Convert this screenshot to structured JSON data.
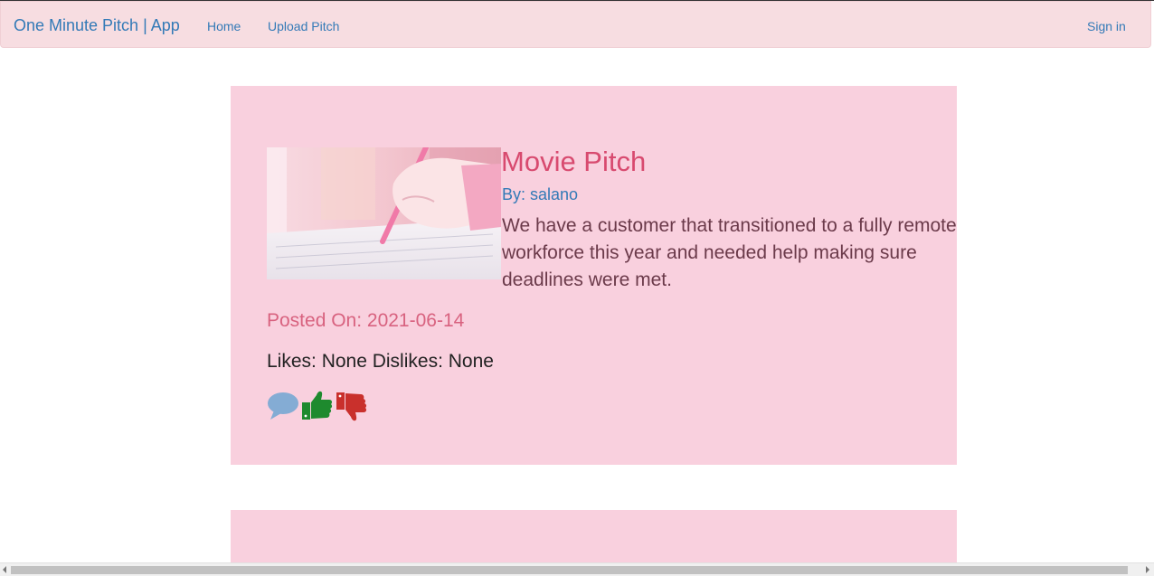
{
  "navbar": {
    "brand": "One Minute Pitch | App",
    "links": [
      {
        "label": "Home"
      },
      {
        "label": "Upload Pitch"
      }
    ],
    "sign_in": "Sign in"
  },
  "pitch": {
    "title": "Movie Pitch",
    "author": "By: salano",
    "description": "We have a customer that transitioned to a fully remote workforce this year and needed help making sure deadlines were met.",
    "posted_on": "Posted On: 2021-06-14",
    "votes": "Likes: None Dislikes: None",
    "image_icon": "pink-anime-writing-hand-image",
    "actions": {
      "comment_icon": "comment-bubble-icon",
      "like_icon": "thumbs-up-icon",
      "dislike_icon": "thumbs-down-icon"
    }
  },
  "colors": {
    "navbar_bg": "#f7dde1",
    "card_bg": "#f9d0de",
    "link": "#337ab7",
    "title": "#d84a6f",
    "like": "#1e8a2e",
    "dislike": "#c9302c",
    "comment": "#84acd4"
  }
}
